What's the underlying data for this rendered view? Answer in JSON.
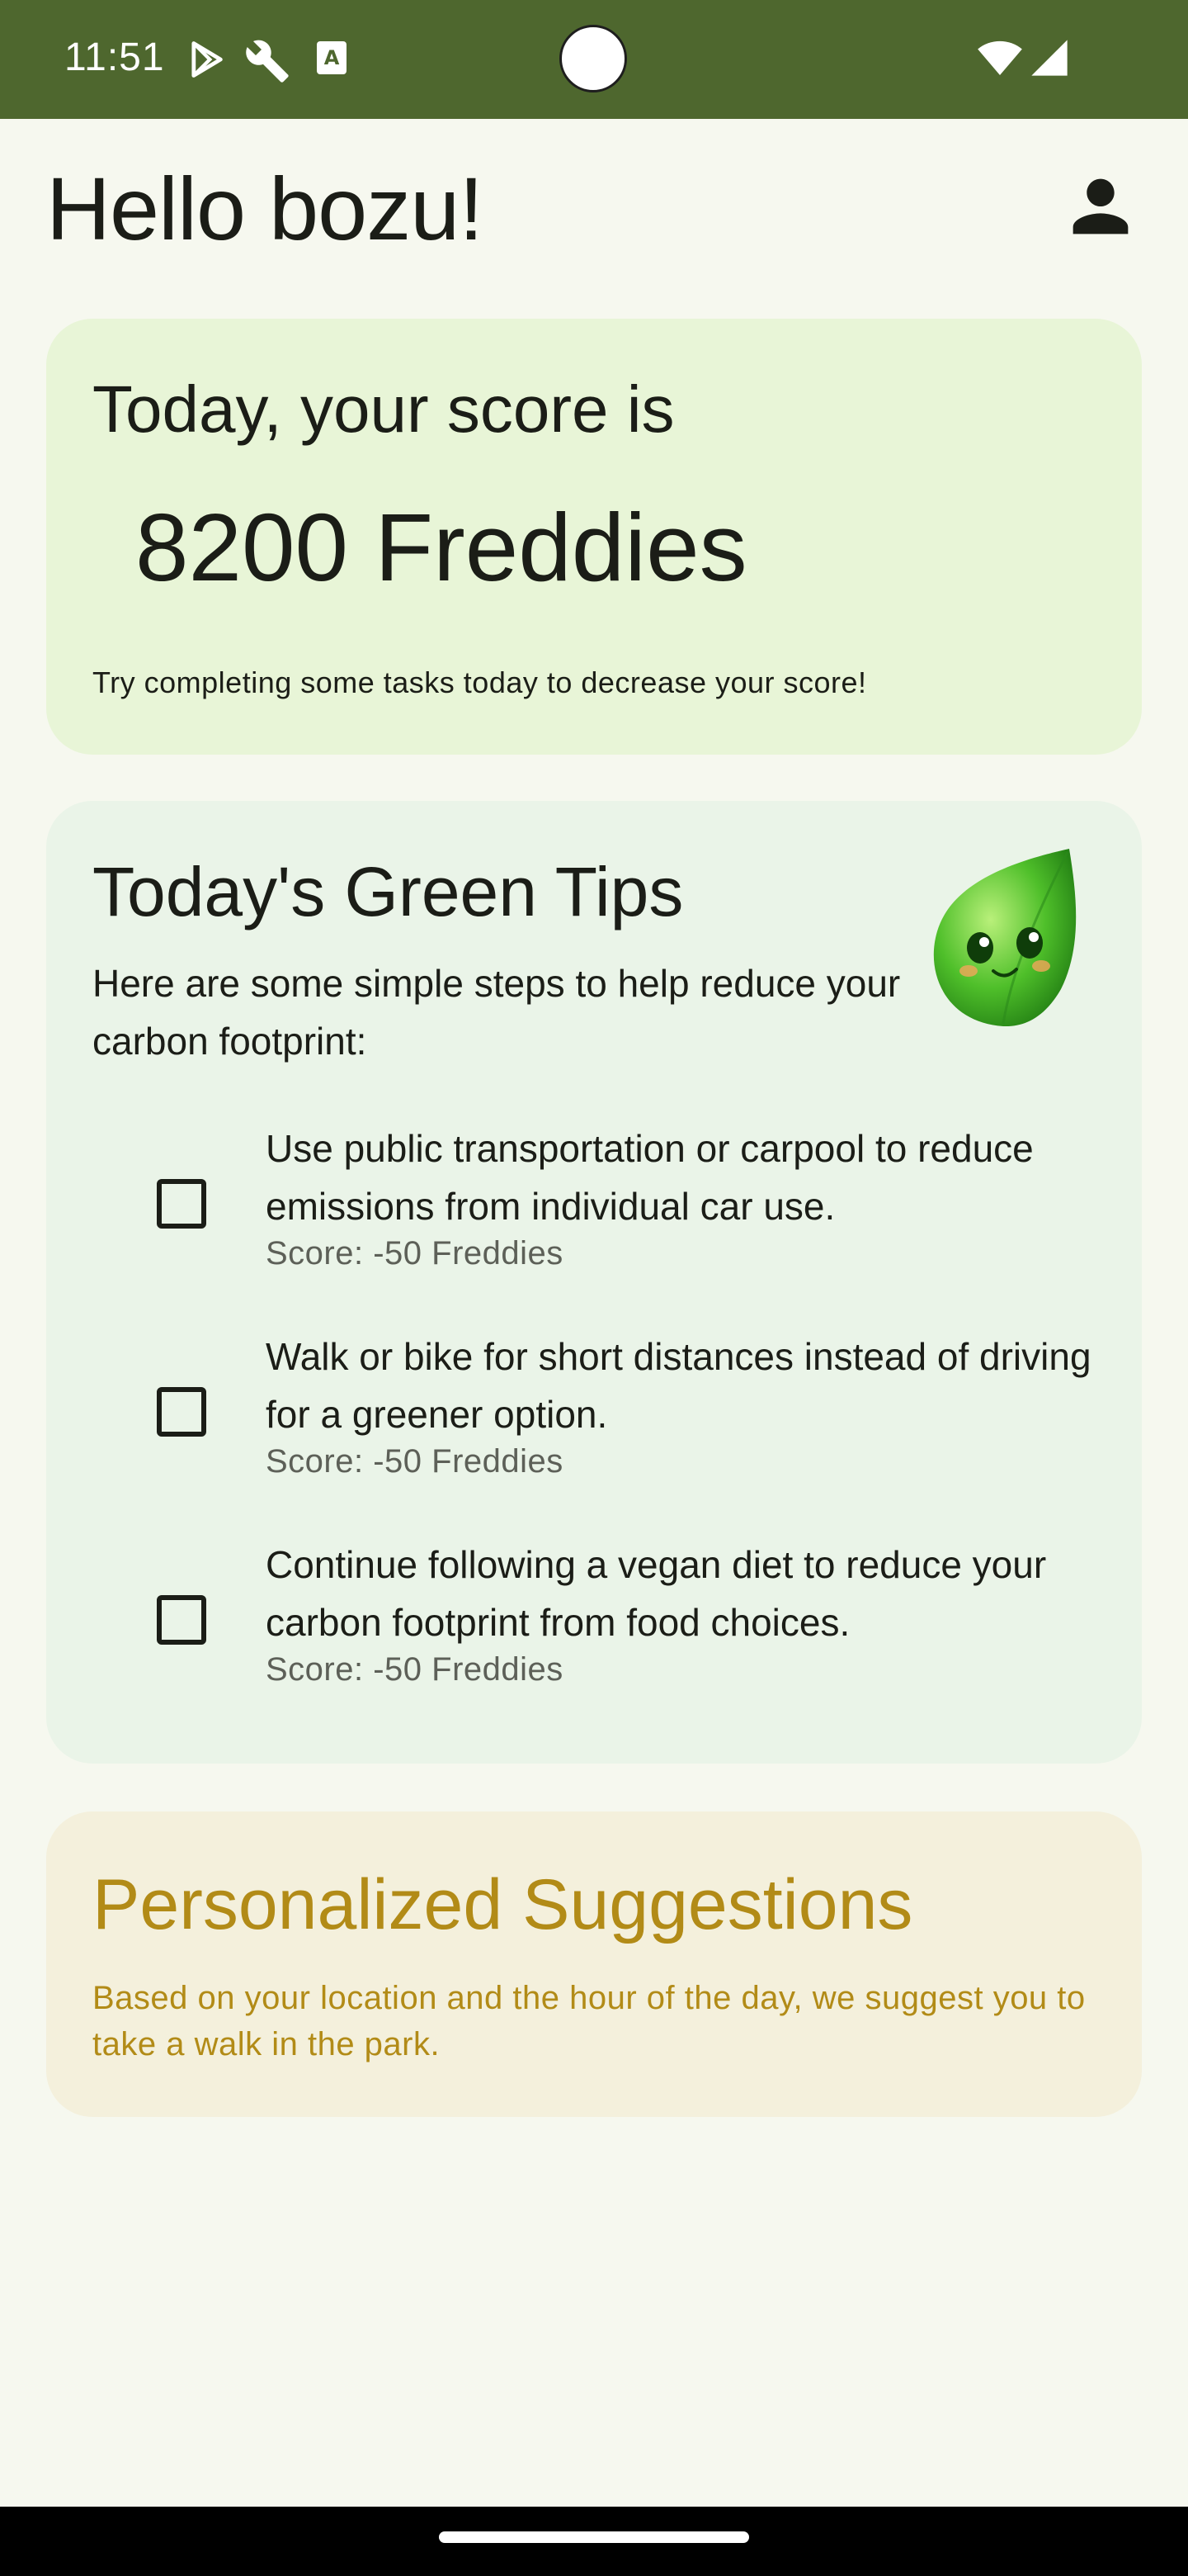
{
  "status_bar": {
    "time": "11:51",
    "icons": [
      "play-store-icon",
      "wrench-icon",
      "text-a-icon",
      "wifi-icon",
      "signal-icon"
    ],
    "background": "#4e672e"
  },
  "header": {
    "greeting": "Hello bozu!",
    "profile_icon": "person-icon"
  },
  "score_card": {
    "title": "Today, your score is",
    "value": "8200 Freddies",
    "hint": "Try completing some tasks today to decrease your score!",
    "background": "#e8f5d7"
  },
  "tips_card": {
    "title": "Today's Green Tips",
    "description": "Here are some simple steps to help reduce your carbon footprint:",
    "mascot_icon": "leaf-mascot-icon",
    "background": "#eaf4e8",
    "tips": [
      {
        "text": "Use public transportation or carpool to reduce emissions from individual car use.",
        "score": "Score: -50 Freddies",
        "checked": false
      },
      {
        "text": "Walk or bike for short distances instead of driving for a greener option.",
        "score": "Score: -50 Freddies",
        "checked": false
      },
      {
        "text": "Continue following a vegan diet to reduce your carbon footprint from food choices.",
        "score": "Score: -50 Freddies",
        "checked": false
      }
    ]
  },
  "suggestions_card": {
    "title": "Personalized Suggestions",
    "text": "Based on your location and the hour of the day, we suggest you to take a walk in the park.",
    "accent_color": "#b28b17",
    "background": "#f4f0dc"
  }
}
